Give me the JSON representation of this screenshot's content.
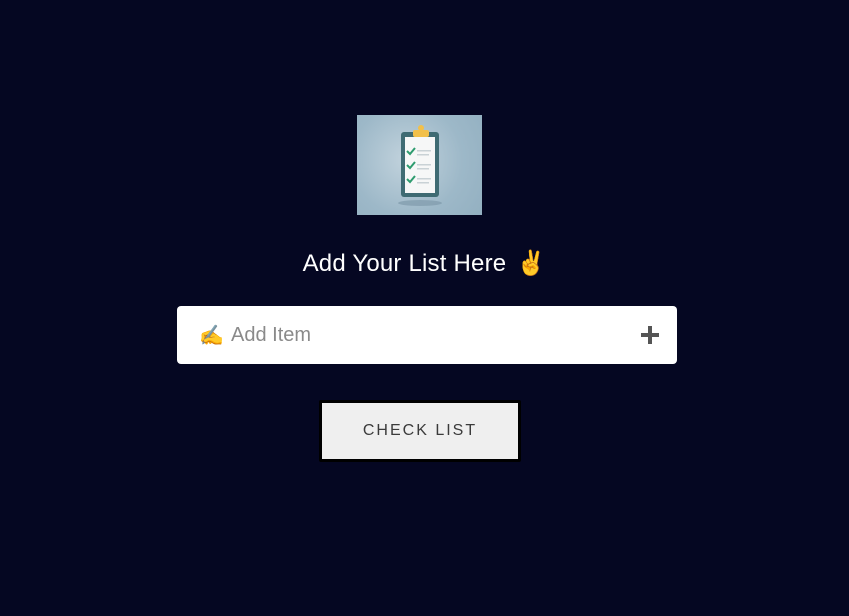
{
  "header": {
    "logo_icon": "clipboard-checklist-icon",
    "title": "Add Your List Here",
    "title_emoji": "✌️"
  },
  "input": {
    "emoji": "✍️",
    "placeholder": "Add Item",
    "value": "",
    "add_icon": "plus-icon"
  },
  "actions": {
    "check_list_label": "CHECK LIST"
  },
  "colors": {
    "background": "#050722",
    "input_bg": "#ffffff",
    "button_bg": "#efefef"
  }
}
